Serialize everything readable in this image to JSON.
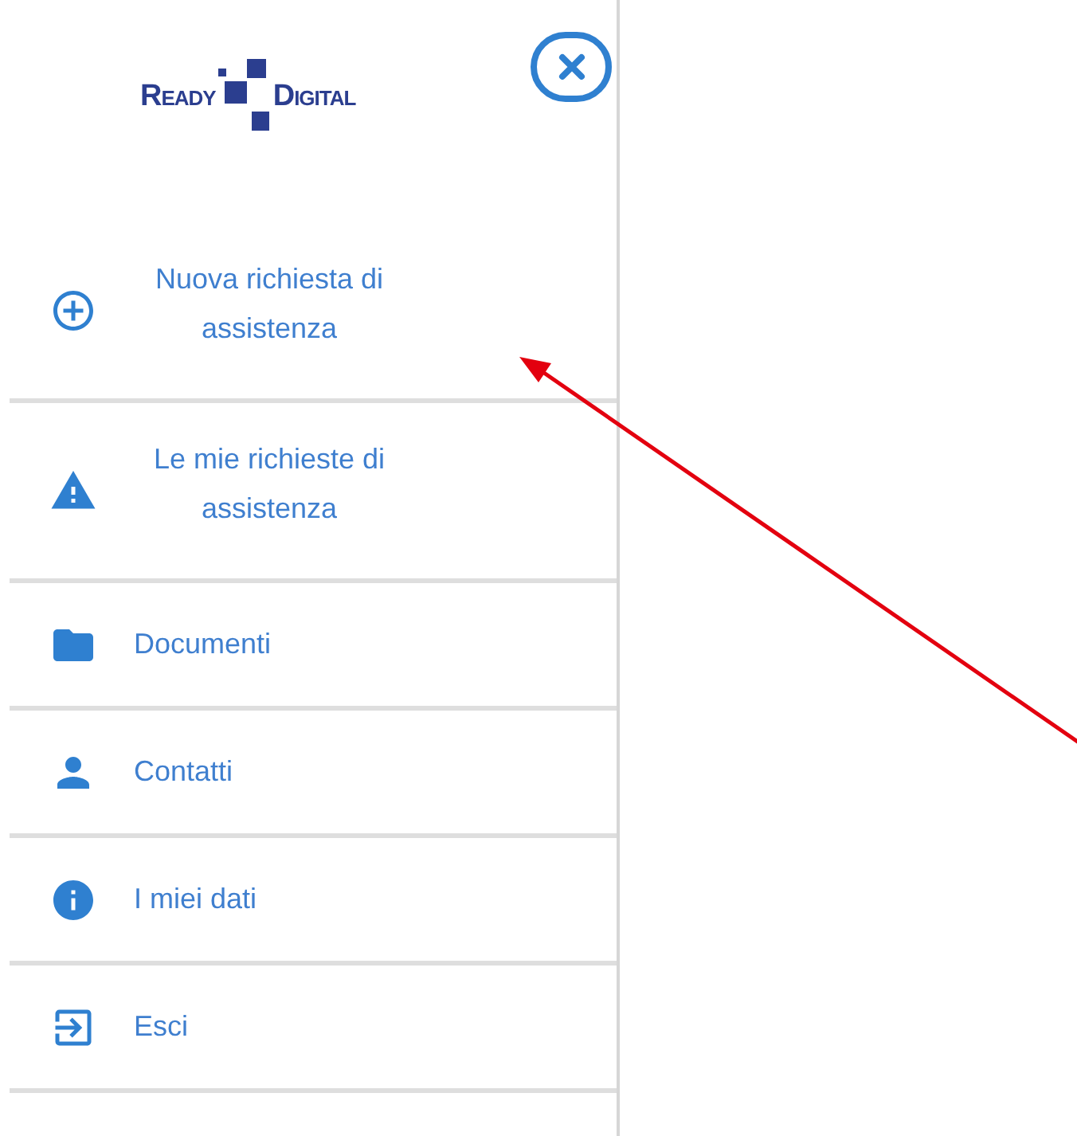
{
  "logo": {
    "left": "Ready",
    "right": "Digital"
  },
  "menu": [
    {
      "kind": "add",
      "label": "Nuova richiesta di assistenza"
    },
    {
      "kind": "warning",
      "label": "Le mie richieste di assistenza"
    },
    {
      "kind": "folder",
      "label": "Documenti"
    },
    {
      "kind": "person",
      "label": "Contatti"
    },
    {
      "kind": "info",
      "label": "I miei dati"
    },
    {
      "kind": "exit",
      "label": "Esci"
    }
  ]
}
